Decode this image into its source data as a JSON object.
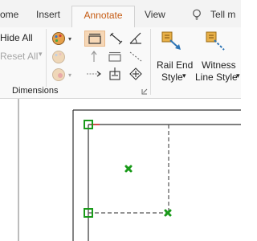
{
  "tabs": {
    "home_partial": "ome",
    "insert": "Insert",
    "annotate": "Annotate",
    "view": "View",
    "tell_me": "Tell m"
  },
  "ribbon": {
    "hide_all": "Hide All",
    "reset_all": "Reset All",
    "group_label": "Dimensions",
    "rail_end_line1": "Rail End",
    "rail_end_line2": "Style",
    "witness_line1": "Witness",
    "witness_line2": "Line Style",
    "dropdown_arrow": "▾"
  },
  "colors": {
    "accent": "#c55a11",
    "handle_green": "#1a9a1a",
    "highlight": "#f6d7b6",
    "origin_red": "#d12b2b"
  },
  "icons": [
    "lightbulb-icon",
    "dimension-style-icon",
    "dimension-icon",
    "aligned-dimension-icon",
    "angular-dimension-icon",
    "rail-end-style-icon",
    "witness-line-style-icon",
    "dialog-launcher-icon"
  ]
}
